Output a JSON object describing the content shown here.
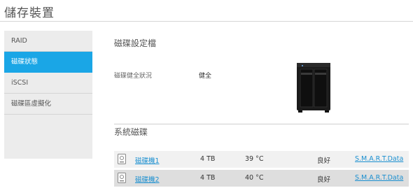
{
  "page": {
    "title": "儲存裝置"
  },
  "sidebar": {
    "items": [
      {
        "label": "RAID"
      },
      {
        "label": "磁碟狀態"
      },
      {
        "label": "iSCSI"
      },
      {
        "label": "磁碟區虛擬化"
      }
    ],
    "active_index": 1
  },
  "profile": {
    "title": "磁碟設定檔",
    "health_label": "磁碟健全狀況",
    "health_value": "健全"
  },
  "system_disks": {
    "title": "系統磁碟",
    "rows": [
      {
        "name": "磁碟機1",
        "size": "4 TB",
        "temp": "39 °C",
        "status": "良好",
        "smart": "S.M.A.R.T.Data"
      },
      {
        "name": "磁碟機2",
        "size": "4 TB",
        "temp": "40 °C",
        "status": "良好",
        "smart": "S.M.A.R.T.Data"
      }
    ]
  },
  "colors": {
    "accent": "#1aa6e6",
    "link": "#1a8fd0"
  },
  "icons": {
    "disk": "disk-drive-icon",
    "device": "nas-device-image"
  }
}
